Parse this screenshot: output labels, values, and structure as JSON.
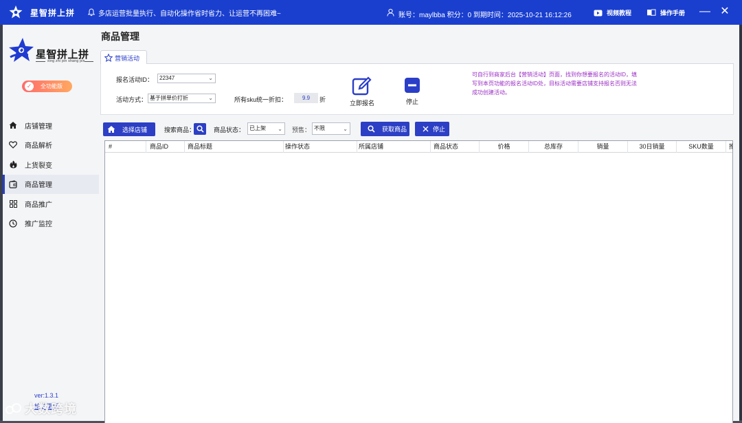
{
  "titlebar": {
    "app_name": "星智拼上拼",
    "notice": "多店运营批量执行、自动化操作省时省力、让运营不再困难~",
    "account_text": "账号：maylbba  积分：0  到期时间：2025-10-21 16:12:26",
    "video_tutorial": "视频教程",
    "manual": "操作手册",
    "minimize": "—",
    "close": "✕"
  },
  "sidebar": {
    "brand_name": "星智拼上拼",
    "brand_pinyin": "xing zhi pin shang pin",
    "energy_button": "全功能版",
    "items": [
      {
        "label": "店铺管理",
        "icon": "home-icon"
      },
      {
        "label": "商品解析",
        "icon": "heart-icon"
      },
      {
        "label": "上货裂变",
        "icon": "flame-icon"
      },
      {
        "label": "商品管理",
        "icon": "wallet-icon"
      },
      {
        "label": "商品推广",
        "icon": "grid-icon"
      },
      {
        "label": "推广监控",
        "icon": "clock-icon"
      }
    ],
    "active_index": 3,
    "version": "ver:1.3.1",
    "update_link": "检查更新"
  },
  "watermark": "大数跨境",
  "page_title": "商品管理",
  "tabs": [
    {
      "label": "营销活动",
      "active": true
    }
  ],
  "activity": {
    "id_label": "报名活动ID：",
    "id_value": "22347",
    "mode_label": "活动方式：",
    "mode_value": "基于拼单价打折",
    "discount_label": "所有sku统一折扣：",
    "discount_value": "9.9",
    "discount_unit": "折",
    "signup_label": "立即报名",
    "stop_label": "停止",
    "hint": "可自行到商家后台【营销活动】页面，找到你想要报名的活动ID，填写到本页功能的报名活动ID处，目标活动需要店铺支持报名否则无法成功创建活动。"
  },
  "toolbar": {
    "select_shop": "选择店铺",
    "search_label": "搜索商品：",
    "status_label": "商品状态：",
    "status_value": "已上架",
    "presale_label": "预售：",
    "presale_value": "不限",
    "fetch_button": "获取商品",
    "stop_button": "停止"
  },
  "table": {
    "columns": [
      "#",
      "商品ID",
      "商品标题",
      "操作状态",
      "所属店铺",
      "商品状态",
      "价格",
      "总库存",
      "销量",
      "30日销量",
      "SKU数量",
      "推"
    ],
    "rows": []
  },
  "colors": {
    "accent": "#2c3fc5",
    "titlebar": "#1a3fcf",
    "hint": "#9b2fc4"
  }
}
